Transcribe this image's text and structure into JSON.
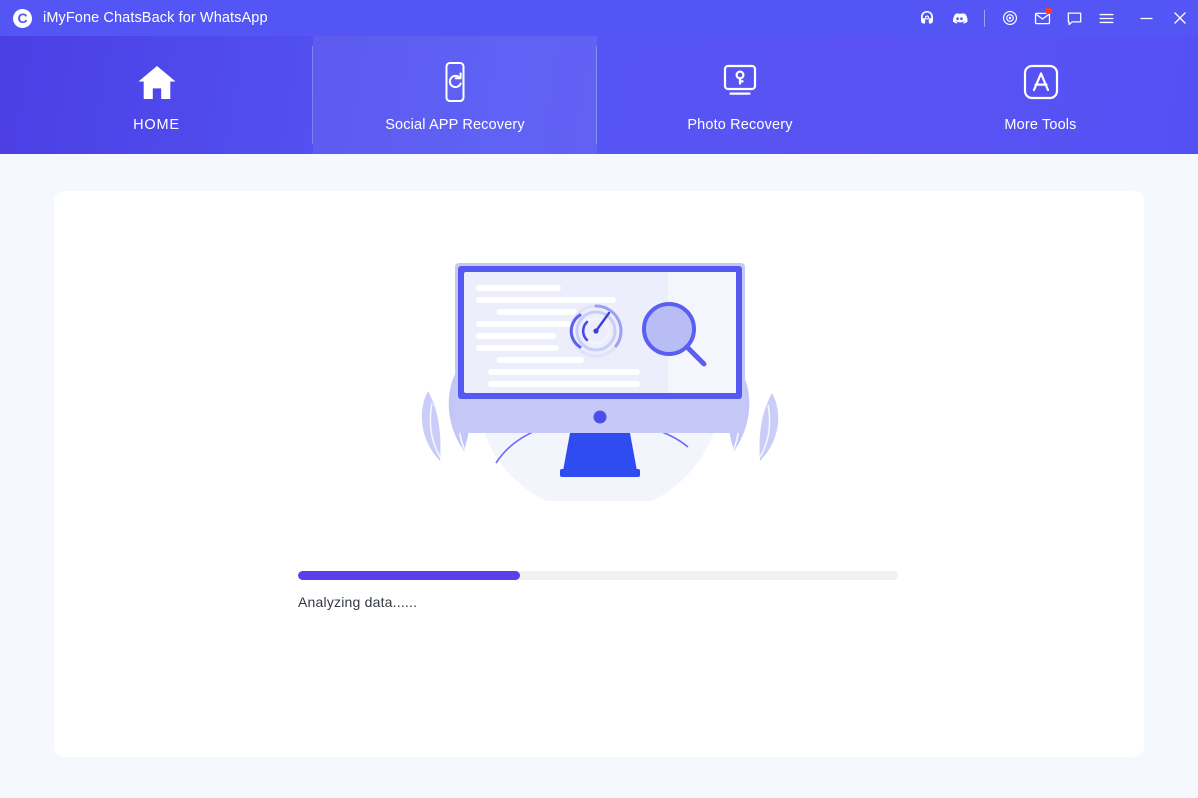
{
  "window": {
    "title": "iMyFone ChatsBack for WhatsApp",
    "logo_icon": "chatsback-logo-icon",
    "accent_color": "#5356f5",
    "nav_gradient_start": "#4b3fe4",
    "nav_gradient_end": "#5451f4",
    "progress_color": "#5b3fe8",
    "badge_color": "#ff3b30",
    "page_background": "#f5f8fc",
    "card_background": "#ffffff"
  },
  "titlebar_actions": [
    {
      "name": "support-headset-icon",
      "label": "Support"
    },
    {
      "name": "discord-icon",
      "label": "Discord"
    },
    {
      "name": "separator",
      "label": ""
    },
    {
      "name": "target-icon",
      "label": "Center"
    },
    {
      "name": "mail-icon",
      "label": "Messages",
      "badge": true
    },
    {
      "name": "chat-bubble-icon",
      "label": "Feedback"
    },
    {
      "name": "hamburger-menu-icon",
      "label": "Menu"
    },
    {
      "name": "minimize-icon",
      "label": "Minimize"
    },
    {
      "name": "close-icon",
      "label": "Close"
    }
  ],
  "nav": {
    "tabs": [
      {
        "label": "HOME",
        "icon": "home-icon",
        "state": "active"
      },
      {
        "label": "Social APP Recovery",
        "icon": "phone-refresh-icon",
        "state": "hover"
      },
      {
        "label": "Photo Recovery",
        "icon": "monitor-key-icon",
        "state": "default"
      },
      {
        "label": "More Tools",
        "icon": "app-store-icon",
        "state": "default"
      }
    ]
  },
  "main": {
    "illustration": "desktop-scan-illustration",
    "progress": {
      "percent": 37,
      "status_text": "Analyzing data......"
    }
  }
}
